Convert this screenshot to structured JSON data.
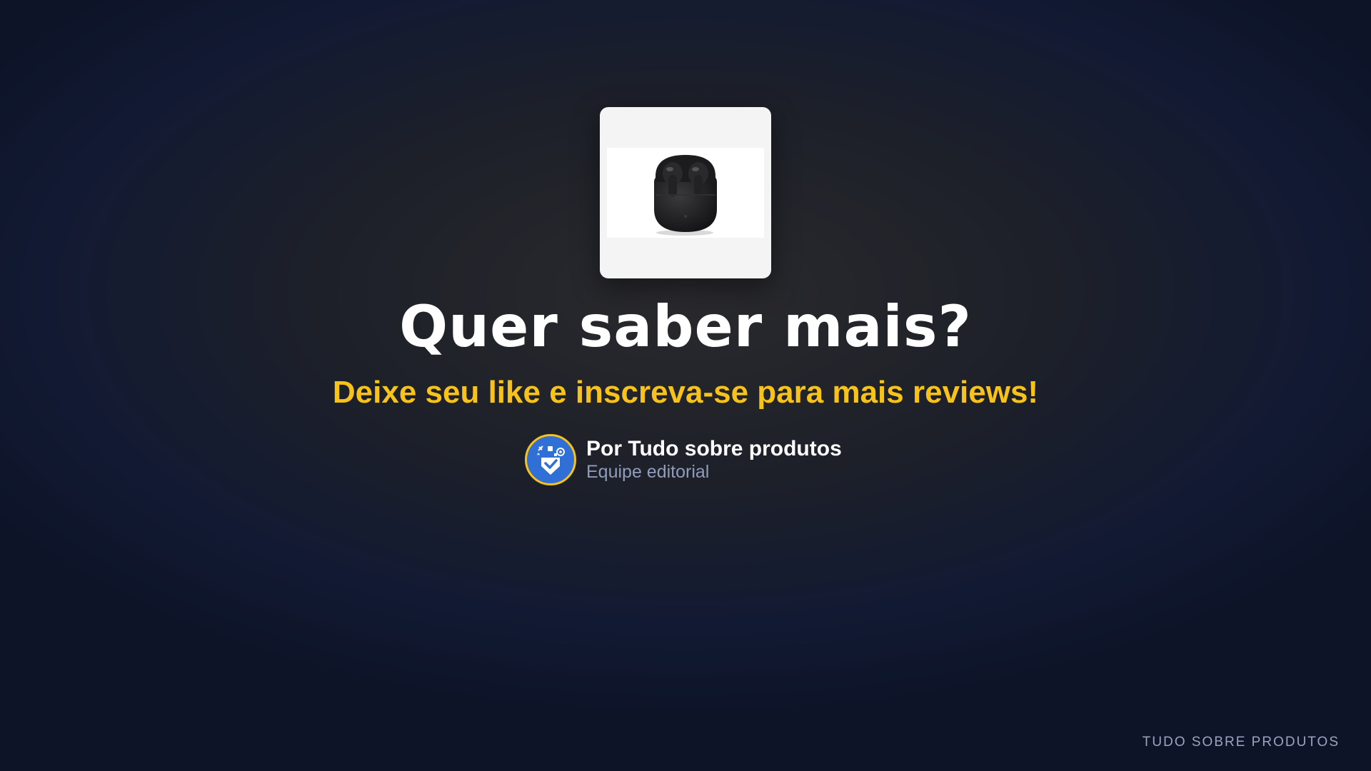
{
  "product": {
    "image_alt": "Black wireless earbuds in charging case"
  },
  "headline": "Quer saber mais?",
  "subline": "Deixe seu like e inscreva-se para mais reviews!",
  "author": {
    "name": "Por Tudo sobre produtos",
    "role": "Equipe editorial",
    "avatar_icon": "brand-logo-icon"
  },
  "watermark": "TUDO SOBRE PRODUTOS",
  "colors": {
    "accent": "#f7c21a",
    "avatar_bg": "#2f6fd6",
    "muted_text": "#8f9cbc",
    "background": "#1d2029"
  }
}
